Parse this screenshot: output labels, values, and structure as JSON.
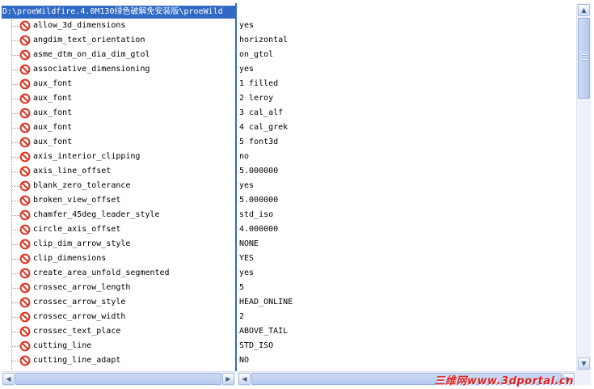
{
  "tree": {
    "path_header": "D:\\proeWildfire.4.0M130绿色破解免安装版\\proeWild",
    "icon": "no-entry-icon"
  },
  "options": [
    {
      "name": "allow_3d_dimensions",
      "value": "yes"
    },
    {
      "name": "angdim_text_orientation",
      "value": "horizontal"
    },
    {
      "name": "asme_dtm_on_dia_dim_gtol",
      "value": "on_gtol"
    },
    {
      "name": "associative_dimensioning",
      "value": "yes"
    },
    {
      "name": "aux_font",
      "value": "1 filled"
    },
    {
      "name": "aux_font",
      "value": "2 leroy"
    },
    {
      "name": "aux_font",
      "value": "3 cal_alf"
    },
    {
      "name": "aux_font",
      "value": "4 cal_grek"
    },
    {
      "name": "aux_font",
      "value": "5 font3d"
    },
    {
      "name": "axis_interior_clipping",
      "value": "no"
    },
    {
      "name": "axis_line_offset",
      "value": "5.000000"
    },
    {
      "name": "blank_zero_tolerance",
      "value": "yes"
    },
    {
      "name": "broken_view_offset",
      "value": "5.000000"
    },
    {
      "name": "chamfer_45deg_leader_style",
      "value": "std_iso"
    },
    {
      "name": "circle_axis_offset",
      "value": "4.000000"
    },
    {
      "name": "clip_dim_arrow_style",
      "value": "NONE"
    },
    {
      "name": "clip_dimensions",
      "value": "YES"
    },
    {
      "name": "create_area_unfold_segmented",
      "value": "yes"
    },
    {
      "name": "crossec_arrow_length",
      "value": "5"
    },
    {
      "name": "crossec_arrow_style",
      "value": "HEAD_ONLINE"
    },
    {
      "name": "crossec_arrow_width",
      "value": "2"
    },
    {
      "name": "crossec_text_place",
      "value": "ABOVE_TAIL"
    },
    {
      "name": "cutting_line",
      "value": "STD_ISO"
    },
    {
      "name": "cutting_line_adapt",
      "value": "NO"
    }
  ],
  "scrollbars": {
    "up_icon": "arrow-up-icon",
    "down_icon": "arrow-down-icon",
    "left_icon": "arrow-left-icon",
    "right_icon": "arrow-right-icon",
    "vertical_position": 0,
    "left_pane_horizontal_position": 0,
    "right_pane_horizontal_position": 0
  },
  "watermark": "三维网www.3dportal.cn",
  "colors": {
    "selection": "#316ac5",
    "icon_red": "#e0301e",
    "watermark": "#e02020"
  }
}
